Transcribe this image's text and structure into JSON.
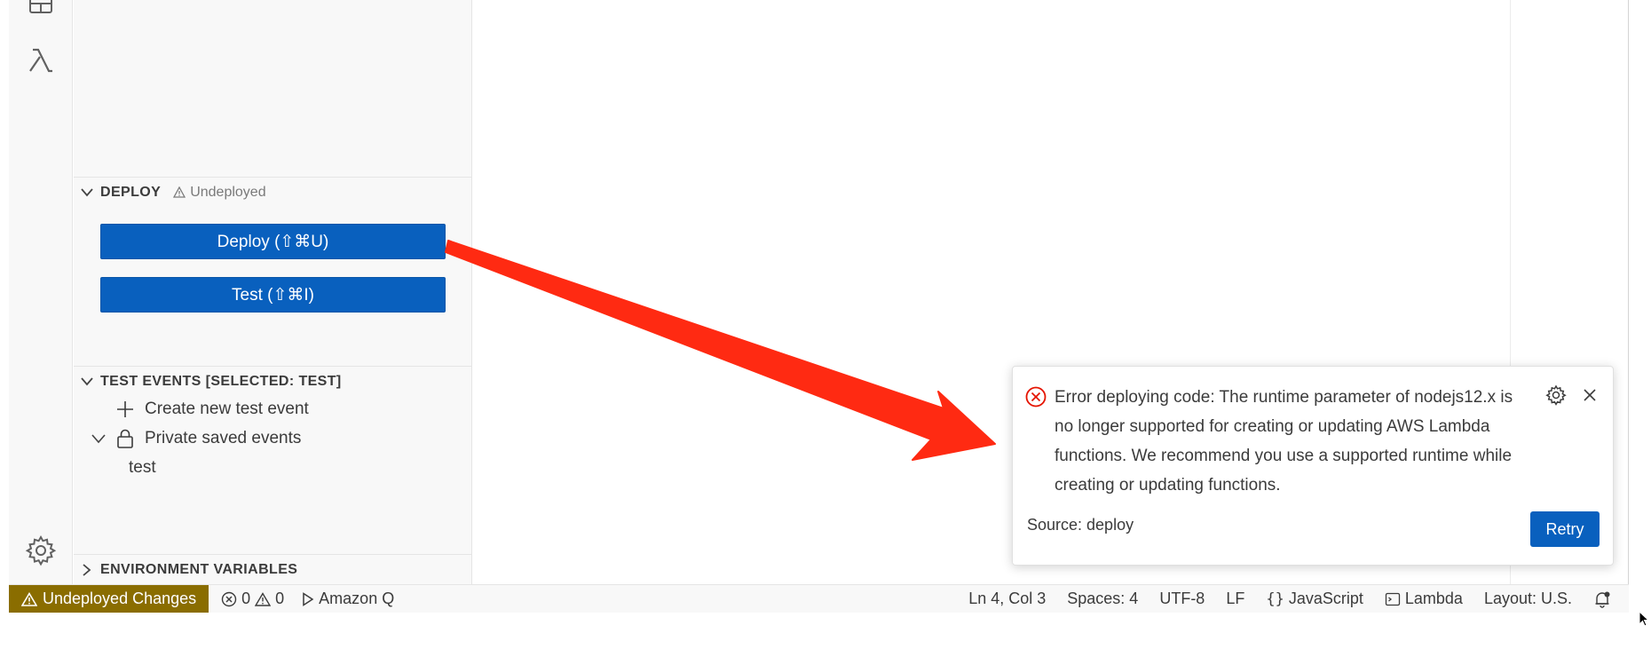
{
  "sidebar": {
    "deploy_section": {
      "title": "DEPLOY",
      "status": "Undeployed",
      "deploy_button": "Deploy (⇧⌘U)",
      "test_button": "Test (⇧⌘I)"
    },
    "test_events_section": {
      "title": "TEST EVENTS [SELECTED: TEST]",
      "create_item": "Create new test event",
      "private_saved": "Private saved events",
      "saved_event": "test"
    },
    "env_section": {
      "title": "ENVIRONMENT VARIABLES"
    }
  },
  "notification": {
    "message": "Error deploying code: The runtime parameter of nodejs12.x is no longer supported for creating or updating AWS Lambda functions. We recommend you use a supported runtime while creating or updating functions.",
    "source": "Source: deploy",
    "retry_label": "Retry"
  },
  "statusbar": {
    "undeployed": "Undeployed Changes",
    "errors": "0",
    "warnings": "0",
    "amazon_q": "Amazon Q",
    "position": "Ln 4, Col 3",
    "spaces": "Spaces: 4",
    "encoding": "UTF-8",
    "eol": "LF",
    "language": "JavaScript",
    "lambda": "Lambda",
    "layout": "Layout: U.S."
  },
  "colors": {
    "accent_blue": "#0960be",
    "undeployed_bg": "#8a6d00",
    "error_red": "#e51400",
    "arrow_red": "#ff2a12"
  }
}
